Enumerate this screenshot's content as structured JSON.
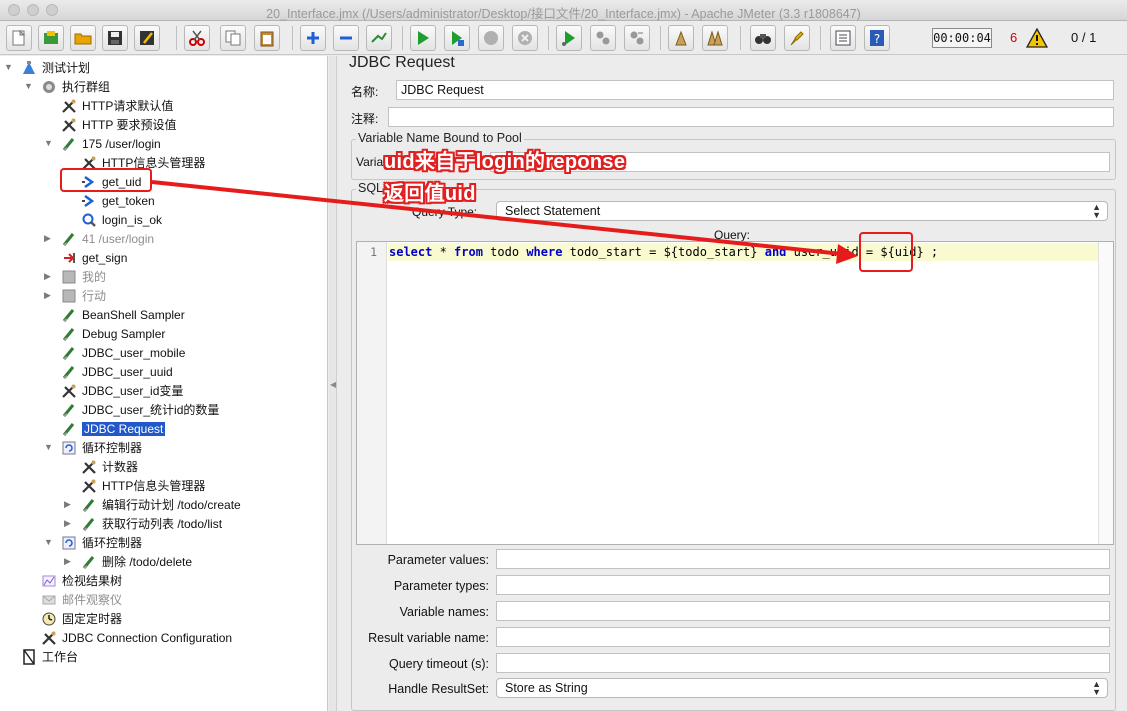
{
  "window": {
    "title": "20_Interface.jmx (/Users/administrator/Desktop/接口文件/20_Interface.jmx) - Apache JMeter (3.3 r1808647)"
  },
  "toolbar": {
    "buttons": [
      "new-icon",
      "templates-icon",
      "open-icon",
      "save-icon",
      "save-as-icon",
      "cut-icon",
      "copy-icon",
      "paste-icon",
      "expand-icon",
      "collapse-icon",
      "toggle-icon",
      "start-icon",
      "start-no-pause-icon",
      "stop-icon",
      "shutdown-icon",
      "remote-start-icon",
      "remote-stop-icon",
      "remote-shutdown-icon",
      "clear-icon",
      "clear-all-icon",
      "search-icon",
      "reset-search-icon",
      "function-helper-icon",
      "help-icon"
    ],
    "elapsed_time": "00:00:04",
    "warning_count": "6",
    "threads": "0 / 1"
  },
  "tree": {
    "nodes": [
      {
        "label": "测试计划",
        "icon": "test-plan-icon"
      },
      {
        "label": "执行群组",
        "icon": "thread-group-icon"
      },
      {
        "label": "HTTP请求默认值",
        "icon": "config-icon"
      },
      {
        "label": "HTTP 要求预设值",
        "icon": "config-icon"
      },
      {
        "label": "175 /user/login",
        "icon": "sampler-icon"
      },
      {
        "label": "HTTP信息头管理器",
        "icon": "config-icon"
      },
      {
        "label": "get_uid",
        "icon": "extractor-icon"
      },
      {
        "label": "get_token",
        "icon": "extractor-icon"
      },
      {
        "label": "login_is_ok",
        "icon": "assertion-icon"
      },
      {
        "label": "41 /user/login",
        "icon": "sampler-icon"
      },
      {
        "label": "get_sign",
        "icon": "preprocessor-icon"
      },
      {
        "label": "我的",
        "icon": "controller-icon"
      },
      {
        "label": "行动",
        "icon": "controller-icon"
      },
      {
        "label": "BeanShell Sampler",
        "icon": "sampler-icon"
      },
      {
        "label": "Debug Sampler",
        "icon": "sampler-icon"
      },
      {
        "label": "JDBC_user_mobile",
        "icon": "sampler-icon"
      },
      {
        "label": "JDBC_user_uuid",
        "icon": "sampler-icon"
      },
      {
        "label": "JDBC_user_id变量",
        "icon": "config-icon"
      },
      {
        "label": "JDBC_user_统计id的数量",
        "icon": "sampler-icon"
      },
      {
        "label": "JDBC Request",
        "icon": "sampler-icon"
      },
      {
        "label": "循环控制器",
        "icon": "loop-controller-icon"
      },
      {
        "label": "计数器",
        "icon": "config-icon"
      },
      {
        "label": "HTTP信息头管理器",
        "icon": "config-icon"
      },
      {
        "label": "编辑行动计划 /todo/create",
        "icon": "sampler-icon"
      },
      {
        "label": "获取行动列表 /todo/list",
        "icon": "sampler-icon"
      },
      {
        "label": "循环控制器",
        "icon": "loop-controller-icon"
      },
      {
        "label": "删除 /todo/delete",
        "icon": "sampler-icon"
      },
      {
        "label": "检视结果树",
        "icon": "listener-icon"
      },
      {
        "label": "邮件观察仪",
        "icon": "mailer-icon"
      },
      {
        "label": "固定定时器",
        "icon": "timer-icon"
      },
      {
        "label": "JDBC Connection Configuration",
        "icon": "config-icon"
      },
      {
        "label": "工作台",
        "icon": "workbench-icon"
      }
    ]
  },
  "panel": {
    "title": "JDBC Request",
    "name_label": "名称:",
    "name_value": "JDBC Request",
    "comments_label": "注释:",
    "comments_value": "",
    "pool_group_title": "Variable Name Bound to Pool",
    "pool_label": "Varia",
    "pool_value": "",
    "sql_group_title": "SQL",
    "query_type_label": "Query Type:",
    "query_type_value": "Select Statement",
    "query_label": "Query:",
    "query_line_number": "1",
    "query_code": {
      "kw1": "select",
      "t1": " * ",
      "kw2": "from",
      "t2": " todo ",
      "kw3": "where",
      "t3": " todo_start = ${todo_start} ",
      "kw4": "and",
      "t4": " user_uuid = ${uid} ;"
    },
    "params": [
      {
        "label": "Parameter values:",
        "value": ""
      },
      {
        "label": "Parameter types:",
        "value": ""
      },
      {
        "label": "Variable names:",
        "value": ""
      },
      {
        "label": "Result variable name:",
        "value": ""
      },
      {
        "label": "Query timeout (s):",
        "value": ""
      }
    ],
    "handle_resultset_label": "Handle ResultSet:",
    "handle_resultset_value": "Store as String"
  },
  "annotation": {
    "line1": "uid来自于login的reponse",
    "line2": "返回值uid",
    "color": "#e61c1c"
  }
}
